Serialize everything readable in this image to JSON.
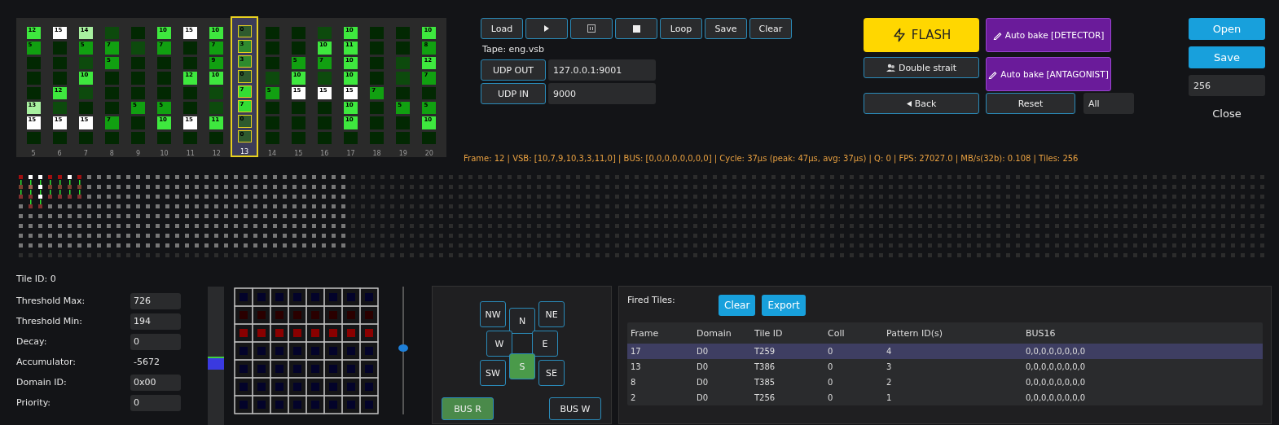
{
  "vsb_panel": {
    "columns": [
      {
        "label": "5",
        "selected": false,
        "cells": [
          {
            "value": "12",
            "color": "#3ee83e"
          },
          {
            "value": "5",
            "color": "#11a011"
          },
          {
            "color": "#022802"
          },
          {
            "color": "#022802"
          },
          {
            "color": "#022802"
          },
          {
            "value": "13",
            "color": "#a8f0a0"
          },
          {
            "value": "15",
            "color": "#ffffff"
          },
          {
            "color": "#022802"
          }
        ]
      },
      {
        "label": "6",
        "selected": false,
        "cells": [
          {
            "value": "15",
            "color": "#ffffff"
          },
          {
            "color": "#022802"
          },
          {
            "color": "#022802"
          },
          {
            "color": "#022802"
          },
          {
            "value": "12",
            "color": "#3ee83e"
          },
          {
            "color": "#0d4a0d"
          },
          {
            "value": "15",
            "color": "#ffffff"
          },
          {
            "color": "#022802"
          }
        ]
      },
      {
        "label": "7",
        "selected": false,
        "cells": [
          {
            "value": "14",
            "color": "#a8f0a0"
          },
          {
            "value": "5",
            "color": "#11a011"
          },
          {
            "color": "#0d4a0d"
          },
          {
            "value": "10",
            "color": "#3ee83e"
          },
          {
            "color": "#0d4a0d"
          },
          {
            "color": "#022802"
          },
          {
            "value": "15",
            "color": "#ffffff"
          },
          {
            "color": "#022802"
          }
        ]
      },
      {
        "label": "8",
        "selected": false,
        "cells": [
          {
            "color": "#0d4a0d"
          },
          {
            "value": "7",
            "color": "#11a011"
          },
          {
            "value": "5",
            "color": "#11a011"
          },
          {
            "color": "#022802"
          },
          {
            "color": "#022802"
          },
          {
            "color": "#022802"
          },
          {
            "value": "7",
            "color": "#11a011"
          },
          {
            "color": "#022802"
          }
        ]
      },
      {
        "label": "9",
        "selected": false,
        "cells": [
          {
            "color": "#022802"
          },
          {
            "color": "#0d4a0d"
          },
          {
            "color": "#022802"
          },
          {
            "color": "#022802"
          },
          {
            "color": "#022802"
          },
          {
            "value": "5",
            "color": "#11a011"
          },
          {
            "color": "#022802"
          },
          {
            "color": "#022802"
          }
        ]
      },
      {
        "label": "10",
        "selected": false,
        "cells": [
          {
            "value": "10",
            "color": "#3ee83e"
          },
          {
            "value": "7",
            "color": "#11a011"
          },
          {
            "color": "#022802"
          },
          {
            "color": "#022802"
          },
          {
            "color": "#022802"
          },
          {
            "value": "5",
            "color": "#11a011"
          },
          {
            "value": "10",
            "color": "#3ee83e"
          },
          {
            "color": "#022802"
          }
        ]
      },
      {
        "label": "11",
        "selected": false,
        "cells": [
          {
            "value": "15",
            "color": "#ffffff"
          },
          {
            "color": "#022802"
          },
          {
            "color": "#022802"
          },
          {
            "value": "12",
            "color": "#3ee83e"
          },
          {
            "color": "#022802"
          },
          {
            "color": "#022802"
          },
          {
            "value": "15",
            "color": "#ffffff"
          },
          {
            "color": "#022802"
          }
        ]
      },
      {
        "label": "12",
        "selected": false,
        "cells": [
          {
            "value": "10",
            "color": "#3ee83e"
          },
          {
            "value": "7",
            "color": "#11a011"
          },
          {
            "value": "9",
            "color": "#11a011"
          },
          {
            "value": "10",
            "color": "#3ee83e"
          },
          {
            "color": "#0d4a0d"
          },
          {
            "color": "#0d4a0d"
          },
          {
            "value": "11",
            "color": "#3ee83e"
          },
          {
            "color": "#022802"
          }
        ]
      },
      {
        "label": "13",
        "selected": true,
        "cells": [
          {
            "value": "0",
            "color": "#2e5a2e"
          },
          {
            "value": "3",
            "color": "#2e8a2e"
          },
          {
            "value": "3",
            "color": "#2e8a2e"
          },
          {
            "value": "0",
            "color": "#2e5a2e"
          },
          {
            "value": "7",
            "color": "#33dd33"
          },
          {
            "value": "7",
            "color": "#33dd33"
          },
          {
            "value": "0",
            "color": "#2e5a2e"
          },
          {
            "value": "0",
            "color": "#2e5a2e"
          }
        ]
      },
      {
        "label": "14",
        "selected": false,
        "cells": [
          {
            "color": "#022802"
          },
          {
            "color": "#022802"
          },
          {
            "color": "#022802"
          },
          {
            "color": "#0d4a0d"
          },
          {
            "value": "5",
            "color": "#11a011"
          },
          {
            "color": "#022802"
          },
          {
            "color": "#022802"
          },
          {
            "color": "#022802"
          }
        ]
      },
      {
        "label": "15",
        "selected": false,
        "cells": [
          {
            "color": "#022802"
          },
          {
            "color": "#022802"
          },
          {
            "value": "5",
            "color": "#11a011"
          },
          {
            "value": "10",
            "color": "#3ee83e"
          },
          {
            "value": "15",
            "color": "#ffffff"
          },
          {
            "color": "#022802"
          },
          {
            "color": "#022802"
          },
          {
            "color": "#022802"
          }
        ]
      },
      {
        "label": "16",
        "selected": false,
        "cells": [
          {
            "color": "#0d4a0d"
          },
          {
            "value": "10",
            "color": "#3ee83e"
          },
          {
            "value": "7",
            "color": "#11a011"
          },
          {
            "color": "#0d4a0d"
          },
          {
            "value": "15",
            "color": "#ffffff"
          },
          {
            "color": "#022802"
          },
          {
            "color": "#022802"
          },
          {
            "color": "#022802"
          }
        ]
      },
      {
        "label": "17",
        "selected": false,
        "cells": [
          {
            "value": "10",
            "color": "#3ee83e"
          },
          {
            "value": "11",
            "color": "#3ee83e"
          },
          {
            "value": "10",
            "color": "#3ee83e"
          },
          {
            "value": "10",
            "color": "#3ee83e"
          },
          {
            "value": "15",
            "color": "#ffffff"
          },
          {
            "value": "10",
            "color": "#3ee83e"
          },
          {
            "value": "10",
            "color": "#3ee83e"
          },
          {
            "color": "#022802"
          }
        ]
      },
      {
        "label": "18",
        "selected": false,
        "cells": [
          {
            "color": "#022802"
          },
          {
            "color": "#022802"
          },
          {
            "color": "#022802"
          },
          {
            "color": "#022802"
          },
          {
            "value": "7",
            "color": "#11a011"
          },
          {
            "color": "#022802"
          },
          {
            "color": "#022802"
          },
          {
            "color": "#022802"
          }
        ]
      },
      {
        "label": "19",
        "selected": false,
        "cells": [
          {
            "color": "#022802"
          },
          {
            "color": "#022802"
          },
          {
            "color": "#0d4a0d"
          },
          {
            "color": "#0d4a0d"
          },
          {
            "color": "#022802"
          },
          {
            "value": "5",
            "color": "#11a011"
          },
          {
            "color": "#022802"
          },
          {
            "color": "#022802"
          }
        ]
      },
      {
        "label": "20",
        "selected": false,
        "cells": [
          {
            "value": "10",
            "color": "#3ee83e"
          },
          {
            "value": "8",
            "color": "#11a011"
          },
          {
            "value": "12",
            "color": "#3ee83e"
          },
          {
            "value": "7",
            "color": "#11a011"
          },
          {
            "color": "#022802"
          },
          {
            "value": "5",
            "color": "#11a011"
          },
          {
            "value": "10",
            "color": "#3ee83e"
          },
          {
            "color": "#022802"
          }
        ]
      }
    ]
  },
  "transport": [
    {
      "kind": "text",
      "label": "Load"
    },
    {
      "kind": "play"
    },
    {
      "kind": "pause"
    },
    {
      "kind": "stop"
    },
    {
      "kind": "text",
      "label": "Loop"
    },
    {
      "kind": "text",
      "label": "Save"
    },
    {
      "kind": "text",
      "label": "Clear"
    }
  ],
  "tape": "Tape: eng.vsb",
  "udp": [
    {
      "button": "UDP OUT",
      "value": "127.0.0.1:9001"
    },
    {
      "button": "UDP IN",
      "value": "9000"
    }
  ],
  "actions": {
    "flash": "FLASH",
    "auto_bake_detector": "Auto bake [DETECTOR]",
    "double_strait": "Double strait",
    "auto_bake_antagonist": "Auto bake [ANTAGONIST]",
    "back": "Back",
    "reset": "Reset",
    "filter": "All"
  },
  "file": {
    "open": "Open",
    "save": "Save",
    "count": "256",
    "close": "Close"
  },
  "status_line": "Frame: 12 | VSB: [10,7,9,10,3,3,11,0] | BUS: [0,0,0,0,0,0,0,0] | Cycle: 37µs (peak: 47µs, avg: 37µs) | Q: 0 | FPS: 27027.0 | MB/s(32b): 0.108 | Tiles: 256",
  "tile_inspector": {
    "title": "Tile ID: 0",
    "fields": [
      {
        "label": "Threshold Max:",
        "value": "726",
        "kind": "input"
      },
      {
        "label": "Threshold Min:",
        "value": "194",
        "kind": "input"
      },
      {
        "label": "Decay:",
        "value": "0",
        "kind": "input"
      },
      {
        "label": "Accumulator:",
        "value": "-5672",
        "kind": "readout"
      },
      {
        "label": "Domain ID:",
        "value": "0x00",
        "kind": "input"
      },
      {
        "label": "Priority:",
        "value": "0",
        "kind": "input"
      }
    ]
  },
  "meter": {
    "level": 0.45
  },
  "pattern_rows": [
    {
      "color": "#03032a"
    },
    {
      "color": "#2a0000"
    },
    {
      "color": "#8a0000"
    },
    {
      "color": "#03032a"
    },
    {
      "color": "#03032a"
    },
    {
      "color": "#03032a"
    },
    {
      "color": "#03032a"
    }
  ],
  "slider": {
    "level": 0.52
  },
  "directions": [
    {
      "label": "NW",
      "selected": false
    },
    {
      "label": "N",
      "selected": false
    },
    {
      "label": "NE",
      "selected": false
    },
    {
      "label": "W",
      "selected": false
    },
    {
      "label": "E",
      "selected": false
    },
    {
      "label": "SW",
      "selected": false
    },
    {
      "label": "S",
      "selected": true
    },
    {
      "label": "SE",
      "selected": false
    }
  ],
  "bus": [
    {
      "label": "BUS R",
      "selected": true
    },
    {
      "label": "BUS W",
      "selected": false
    }
  ],
  "fired_tiles": {
    "title": "Fired Tiles:",
    "buttons": [
      "Clear",
      "Export"
    ],
    "columns": [
      "Frame",
      "Domain",
      "Tile ID",
      "Coll",
      "Pattern ID(s)",
      "BUS16"
    ],
    "rows": [
      {
        "selected": true,
        "cells": [
          "17",
          "D0",
          "T259",
          "0",
          "4",
          "0,0,0,0,0,0,0,0"
        ]
      },
      {
        "selected": false,
        "cells": [
          "13",
          "D0",
          "T386",
          "0",
          "3",
          "0,0,0,0,0,0,0,0"
        ]
      },
      {
        "selected": false,
        "cells": [
          "8",
          "D0",
          "T385",
          "0",
          "2",
          "0,0,0,0,0,0,0,0"
        ]
      },
      {
        "selected": false,
        "cells": [
          "2",
          "D0",
          "T256",
          "0",
          "1",
          "0,0,0,0,0,0,0,0"
        ]
      }
    ]
  }
}
